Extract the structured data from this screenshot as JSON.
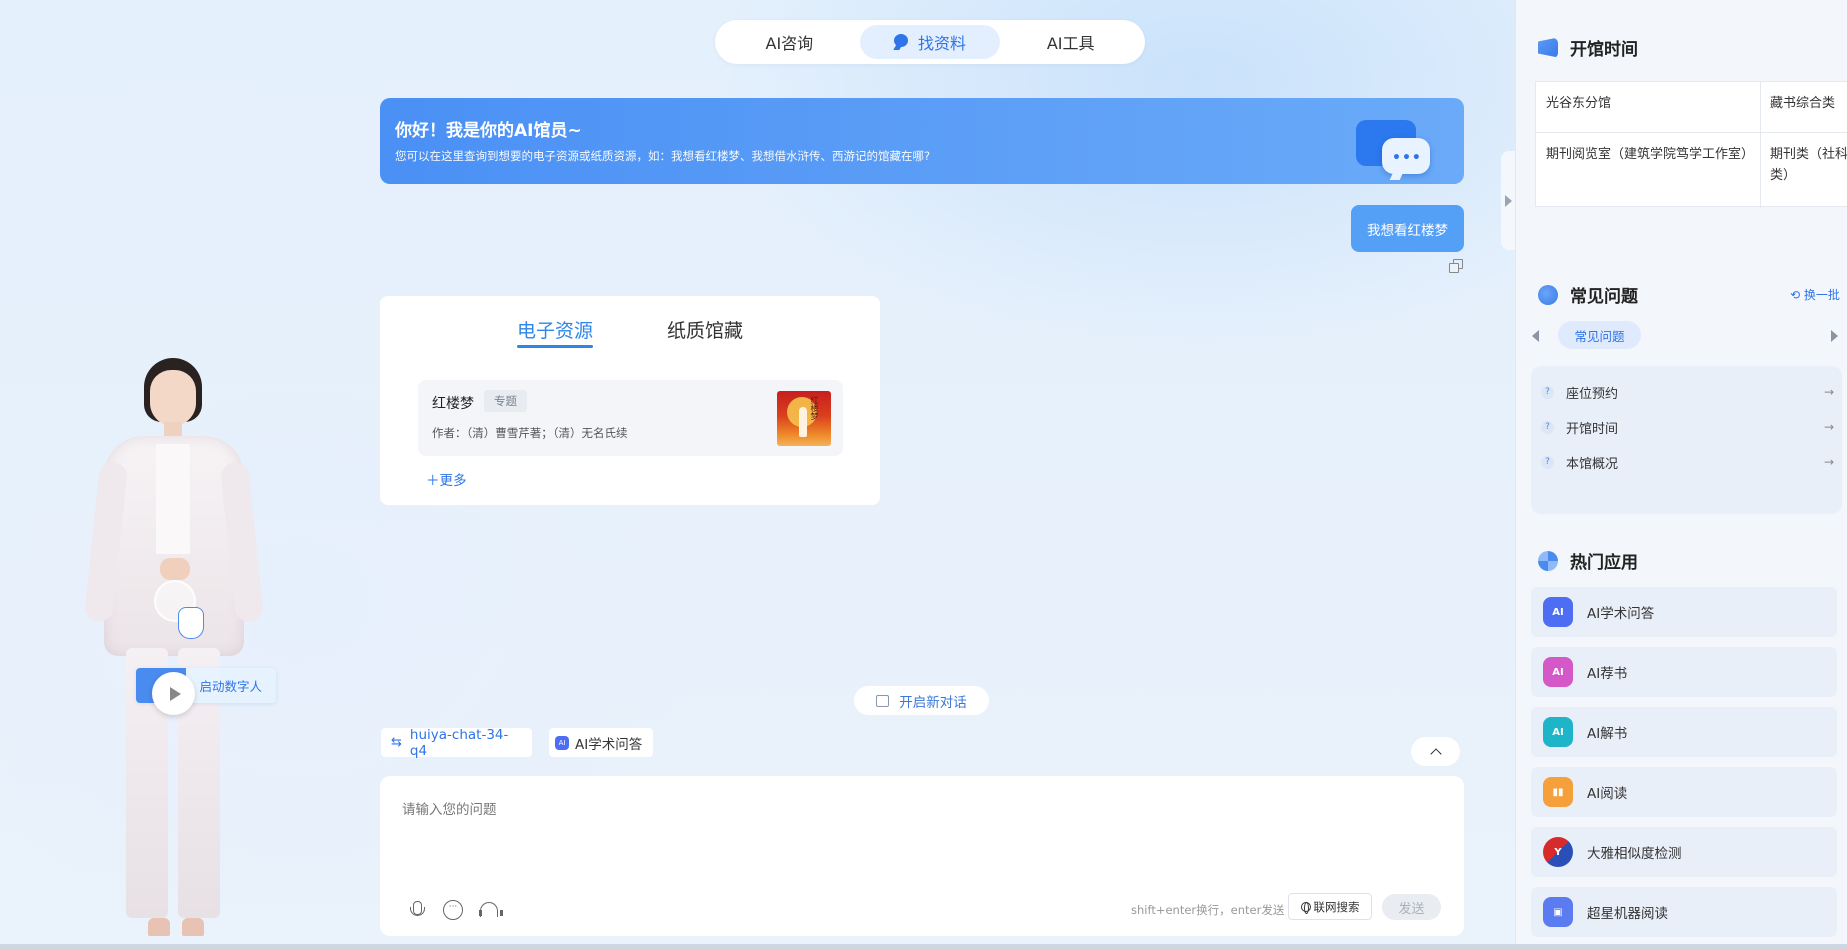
{
  "top_tabs": [
    {
      "label": "AI咨询",
      "active": false
    },
    {
      "label": "找资料",
      "active": true
    },
    {
      "label": "AI工具",
      "active": false
    }
  ],
  "welcome": {
    "title": "你好！我是你的AI馆员~",
    "subtitle": "您可以在这里查询到想要的电子资源或纸质资源，如：我想看红楼梦、我想借水浒传、西游记的馆藏在哪?"
  },
  "user_message": "我想看红楼梦",
  "resource_card": {
    "tabs": [
      {
        "label": "电子资源",
        "active": true
      },
      {
        "label": "纸质馆藏",
        "active": false
      }
    ],
    "book": {
      "title": "红楼梦",
      "tag": "专题",
      "author": "作者：（清）曹雪芹著；（清）无名氏续",
      "cover_text": "红楼梦"
    },
    "more_label": "＋更多"
  },
  "new_chat_label": "开启新对话",
  "model_chip": {
    "icon": "swap-icon",
    "label": "huiya-chat-34-q4"
  },
  "app_chip": {
    "icon": "ai-academic-icon",
    "label": "AI学术问答"
  },
  "input": {
    "placeholder": "请输入您的问题",
    "hint": "shift+enter换行，enter发送",
    "web_search_label": "联网搜索",
    "send_label": "发送"
  },
  "digital_human": {
    "start_label": "启动数字人"
  },
  "right_panel": {
    "hours": {
      "title": "开馆时间",
      "rows": [
        [
          "光谷东分馆",
          "藏书综合类"
        ],
        [
          "期刊阅览室（建筑学院笃学工作室）",
          "期刊类（社科类）"
        ]
      ]
    },
    "faq": {
      "title": "常见问题",
      "refresh_label": "换一批",
      "category": "常见问题",
      "items": [
        "座位预约",
        "开馆时间",
        "本馆概况"
      ]
    },
    "hot_apps": {
      "title": "热门应用",
      "items": [
        {
          "label": "AI学术问答",
          "icon": "ai-academic-icon",
          "color": "#4d6ef3"
        },
        {
          "label": "AI荐书",
          "icon": "ai-recommend-icon",
          "color": "#d458c8"
        },
        {
          "label": "AI解书",
          "icon": "ai-explain-icon",
          "color": "#1fb5c8"
        },
        {
          "label": "AI阅读",
          "icon": "ai-reading-icon",
          "color": "#f5a03a"
        },
        {
          "label": "大雅相似度检测",
          "icon": "daya-similarity-icon",
          "color": "#d72a2a"
        },
        {
          "label": "超星机器阅读",
          "icon": "chaoxing-robot-icon",
          "color": "#5a7cf0"
        }
      ]
    }
  },
  "colors": {
    "accent": "#2f74e8",
    "banner": "#4a90f5",
    "user_bubble": "#55a0f7"
  }
}
